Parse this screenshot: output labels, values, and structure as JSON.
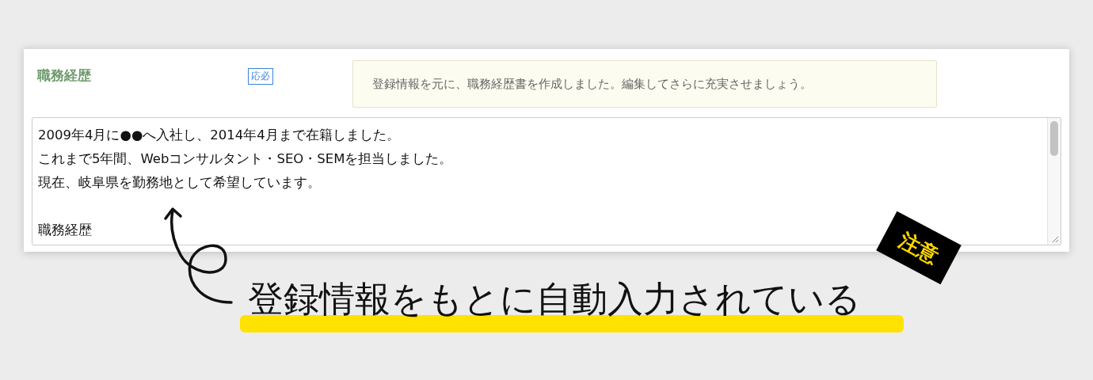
{
  "section": {
    "title": "職務経歴",
    "badge": "応必",
    "notice": "登録情報を元に、職務経歴書を作成しました。編集してさらに充実させましょう。"
  },
  "textarea": {
    "paragraphs": [
      [
        "2009年4月に●●へ入社し、2014年4月まで在籍しました。",
        "これまで5年間、Webコンサルタント・SEO・SEMを担当しました。",
        "現在、岐阜県を勤務地として希望しています。"
      ],
      [
        "職務経歴"
      ]
    ]
  },
  "annotation": {
    "caption": "登録情報をもとに自動入力されている",
    "sticker": "注意"
  }
}
